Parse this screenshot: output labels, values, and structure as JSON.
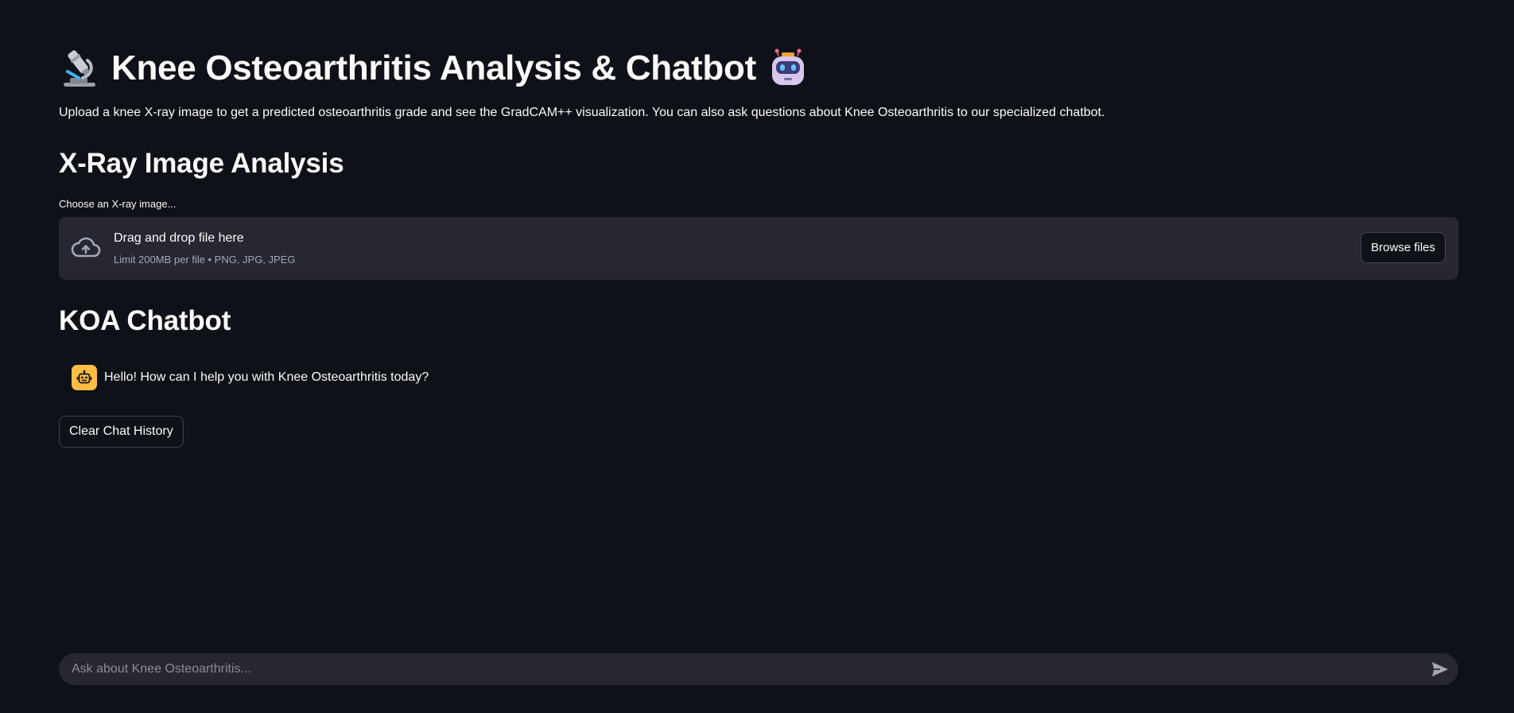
{
  "header": {
    "title": "Knee Osteoarthritis Analysis & Chatbot",
    "left_emoji": "microscope-icon",
    "right_emoji": "robot-icon",
    "description": "Upload a knee X-ray image to get a predicted osteoarthritis grade and see the GradCAM++ visualization. You can also ask questions about Knee Osteoarthritis to our specialized chatbot."
  },
  "xray_section": {
    "heading": "X-Ray Image Analysis",
    "uploader_label": "Choose an X-ray image...",
    "dropzone_title": "Drag and drop file here",
    "dropzone_limit": "Limit 200MB per file • PNG, JPG, JPEG",
    "browse_label": "Browse files",
    "icon": "cloud-upload-icon"
  },
  "chat_section": {
    "heading": "KOA Chatbot",
    "messages": [
      {
        "role": "assistant",
        "avatar": "bot-icon",
        "text": "Hello! How can I help you with Knee Osteoarthritis today?"
      }
    ],
    "clear_label": "Clear Chat History",
    "input_placeholder": "Ask about Knee Osteoarthritis...",
    "send_icon": "send-icon"
  },
  "colors": {
    "background": "#0e1117",
    "panel": "#262730",
    "avatar": "#ffbd45",
    "text": "#fafafa"
  }
}
